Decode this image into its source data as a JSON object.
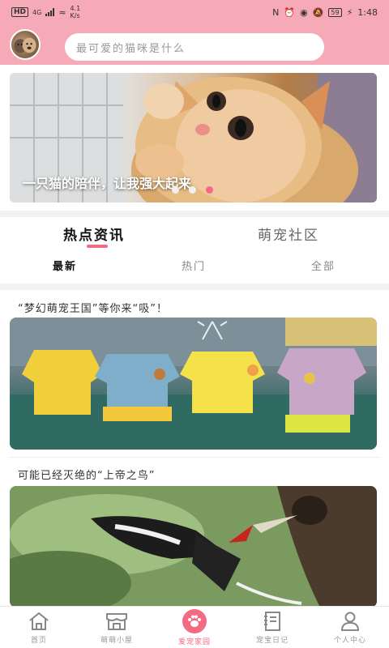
{
  "status_bar": {
    "network": "HD",
    "signal_label": "4G",
    "speed": "4.1",
    "speed_unit": "K/s",
    "battery": "59",
    "time": "1:48"
  },
  "header": {
    "search_placeholder": "最可爱的猫咪是什么"
  },
  "banner": {
    "caption": "一只猫的陪伴，让我强大起来",
    "slide_count": 3,
    "active_slide_index": 2
  },
  "tabs": {
    "items": [
      "热点资讯",
      "萌宠社区"
    ],
    "active": 0,
    "accent_color": "#f46a85"
  },
  "subtabs": {
    "items": [
      "最新",
      "热门",
      "全部"
    ],
    "active": 0
  },
  "articles": [
    {
      "title": "“梦幻萌宠王国”等你来“吸”！",
      "image": "pet-clothes-display"
    },
    {
      "title": "可能已经灭绝的“上帝之鸟”",
      "image": "woodpecker-photo"
    }
  ],
  "bottom_nav": {
    "items": [
      {
        "label": "首页",
        "icon": "home-icon"
      },
      {
        "label": "萌萌小屋",
        "icon": "store-icon"
      },
      {
        "label": "爱宠家园",
        "icon": "paw-icon"
      },
      {
        "label": "宠宝日记",
        "icon": "notebook-icon"
      },
      {
        "label": "个人中心",
        "icon": "user-icon"
      }
    ],
    "active": 2
  },
  "colors": {
    "header_pink": "#f6a9b7",
    "accent": "#f46a85"
  }
}
